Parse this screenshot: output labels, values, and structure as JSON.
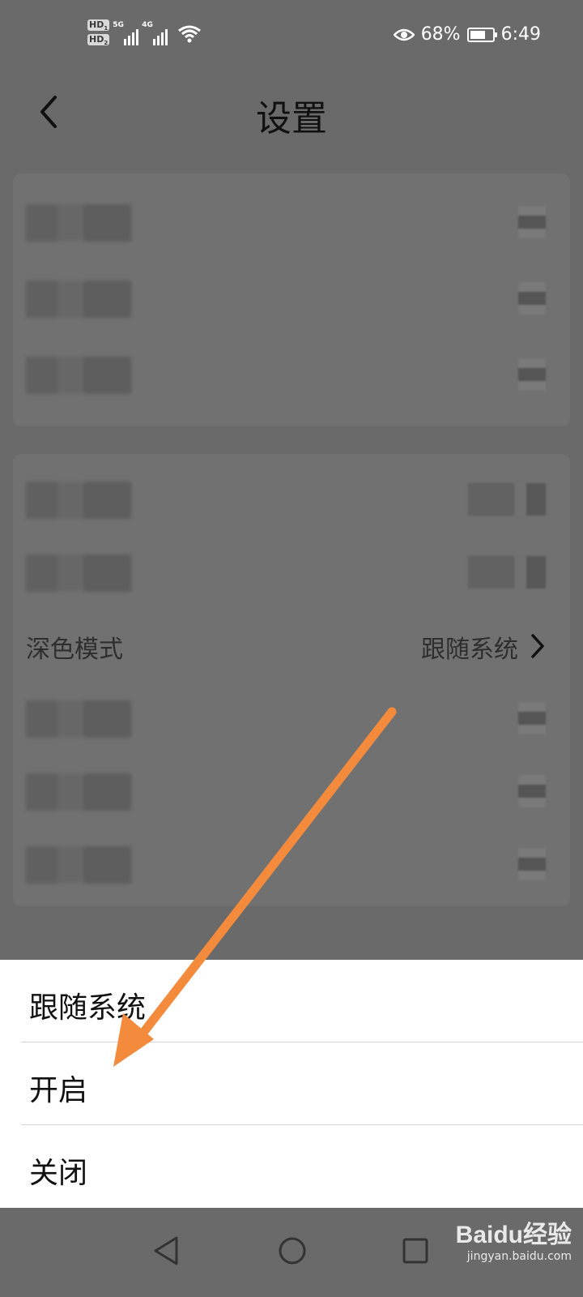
{
  "status_bar": {
    "hd1": "HD",
    "hd1_sub": "1",
    "hd2": "HD",
    "hd2_sub": "2",
    "net1": "5G",
    "net2": "4G",
    "battery_percent": "68%",
    "battery_level": 0.68,
    "time": "6:49"
  },
  "header": {
    "title": "设置",
    "back_icon": "chevron-left-icon"
  },
  "settings": {
    "dark_mode_label": "深色模式",
    "dark_mode_value": "跟随系统"
  },
  "sheet": {
    "options": [
      "跟随系统",
      "开启",
      "关闭"
    ]
  },
  "watermark": {
    "logo": "Baidu经验",
    "url": "jingyan.baidu.com"
  },
  "colors": {
    "overlay_gray": "#6a6a6a",
    "sheet_bg": "#ffffff",
    "annotation_arrow": "#f38a3c"
  }
}
